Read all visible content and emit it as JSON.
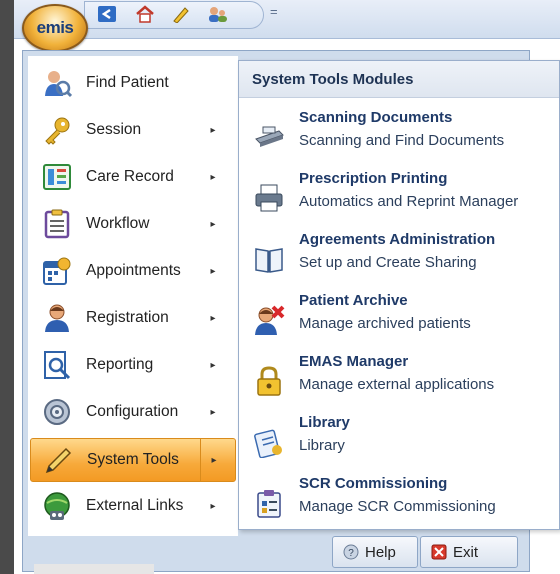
{
  "app": {
    "logo_text": "emis"
  },
  "quick_access": {
    "icons": [
      "back-arrow-icon",
      "home-icon",
      "edit-icon",
      "users-icon"
    ],
    "customize": "="
  },
  "menu": {
    "items": [
      {
        "label": "Find Patient",
        "icon": "find-patient-icon",
        "submenu": false
      },
      {
        "label": "Session",
        "icon": "key-icon",
        "submenu": true
      },
      {
        "label": "Care Record",
        "icon": "care-record-icon",
        "submenu": true
      },
      {
        "label": "Workflow",
        "icon": "workflow-icon",
        "submenu": true
      },
      {
        "label": "Appointments",
        "icon": "calendar-icon",
        "submenu": true
      },
      {
        "label": "Registration",
        "icon": "registration-icon",
        "submenu": true
      },
      {
        "label": "Reporting",
        "icon": "reporting-icon",
        "submenu": true
      },
      {
        "label": "Configuration",
        "icon": "configuration-icon",
        "submenu": true
      },
      {
        "label": "System Tools",
        "icon": "pencil-icon",
        "submenu": true,
        "active": true
      },
      {
        "label": "External Links",
        "icon": "globe-icon",
        "submenu": true
      }
    ],
    "arrow_glyph": "▸"
  },
  "submenu": {
    "header": "System Tools Modules",
    "items": [
      {
        "title": "Scanning  Documents",
        "desc": "Scanning and Find Documents",
        "icon": "scanner-icon"
      },
      {
        "title": "Prescription Printing",
        "desc": "Automatics and Reprint Manager",
        "icon": "printer-icon"
      },
      {
        "title": "Agreements Administration",
        "desc": "Set up and Create Sharing",
        "icon": "book-icon"
      },
      {
        "title": "Patient Archive",
        "desc": "Manage archived patients",
        "icon": "patient-archive-icon"
      },
      {
        "title": "EMAS Manager",
        "desc": "Manage external applications",
        "icon": "lock-icon"
      },
      {
        "title": "Library",
        "desc": "Library",
        "icon": "library-icon"
      },
      {
        "title": "SCR Commissioning",
        "desc": "Manage SCR Commissioning",
        "icon": "scr-icon"
      }
    ]
  },
  "footer": {
    "help_label": "Help",
    "exit_label": "Exit"
  }
}
